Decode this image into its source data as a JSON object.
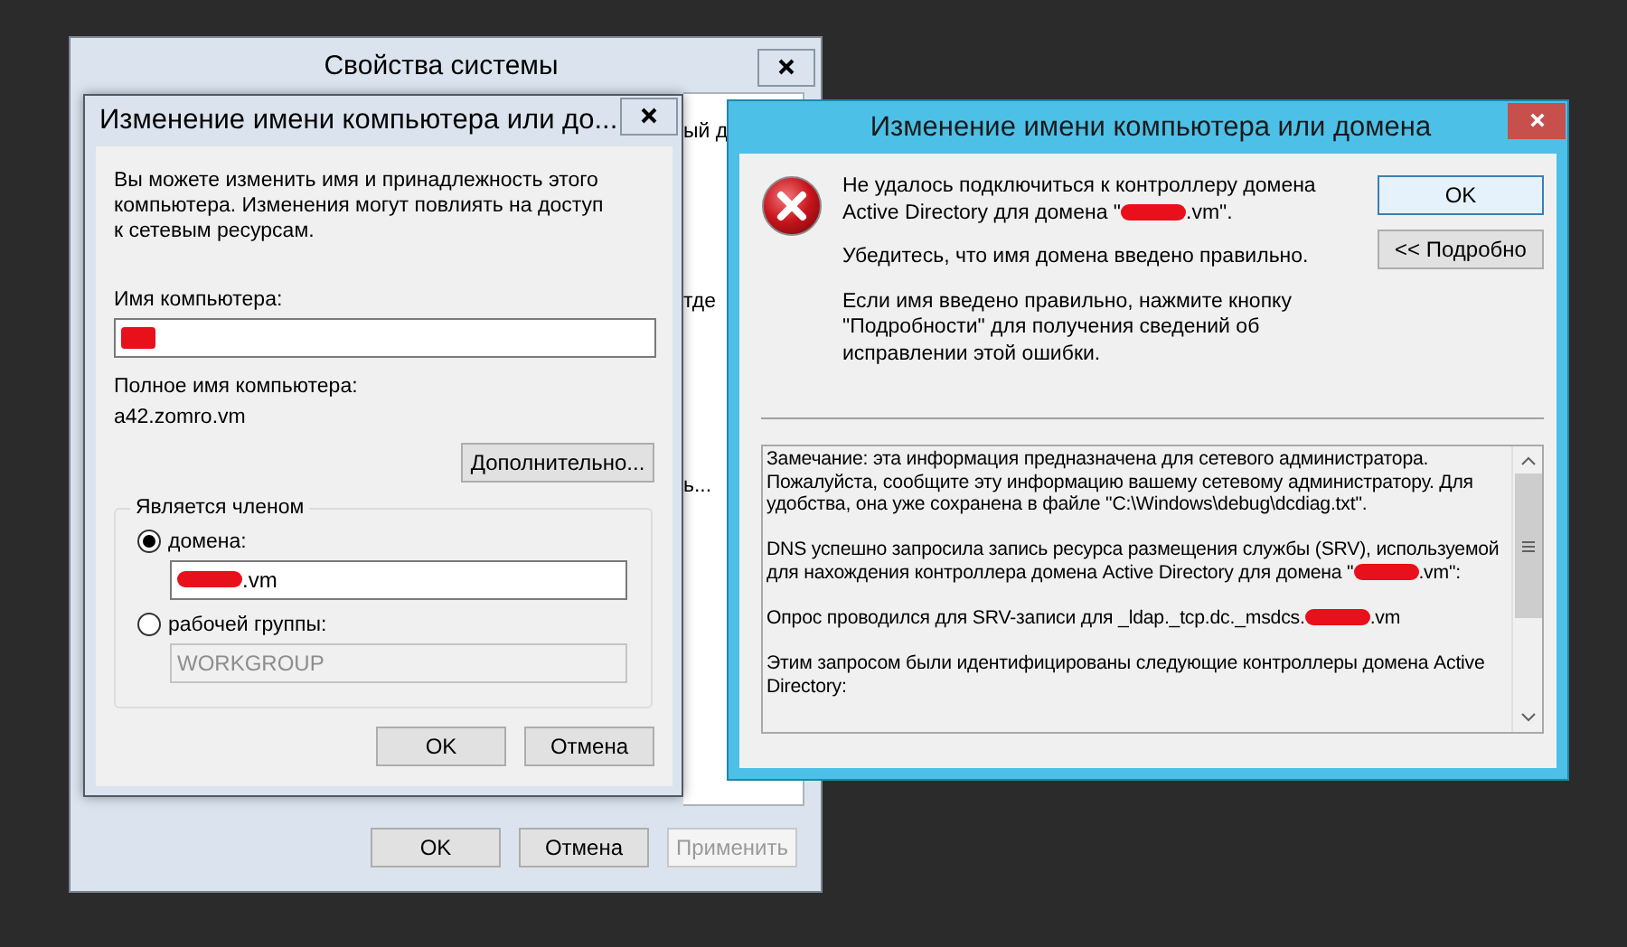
{
  "system_properties": {
    "title": "Свойства системы",
    "behind_fragments": [
      "ый д",
      "тде",
      "ь..."
    ],
    "buttons": [
      {
        "label": "OK",
        "disabled": false
      },
      {
        "label": "Отмена",
        "disabled": false
      },
      {
        "label": "Применить",
        "disabled": true
      }
    ]
  },
  "rename_dialog": {
    "title": "Изменение имени компьютера или до...",
    "intro": "Вы можете изменить имя и принадлежность этого компьютера. Изменения могут повлиять на доступ к сетевым ресурсам.",
    "computer_name_label": "Имя компьютера:",
    "computer_name_value": [
      {
        "kind": "redacted"
      }
    ],
    "full_name_label": "Полное имя компьютера:",
    "full_name": "a42.zomro.vm",
    "more_button": "Дополнительно...",
    "member_of": {
      "legend": "Является членом",
      "options": [
        {
          "label": "домена:",
          "selected": true,
          "disabled": false,
          "value": [
            {
              "kind": "redacted"
            },
            {
              "kind": "text",
              "text": ".vm"
            }
          ]
        },
        {
          "label": "рабочей группы:",
          "selected": false,
          "disabled": true,
          "value": [
            {
              "kind": "text",
              "text": "WORKGROUP"
            }
          ]
        }
      ]
    },
    "buttons": [
      {
        "label": "OK",
        "disabled": false
      },
      {
        "label": "Отмена",
        "disabled": false
      }
    ]
  },
  "error_dialog": {
    "title": "Изменение имени компьютера или домена",
    "message": [
      [
        {
          "kind": "text",
          "text": "Не удалось подключиться к контроллеру домена Active Directory для домена \""
        },
        {
          "kind": "redacted"
        },
        {
          "kind": "text",
          "text": ".vm\"."
        }
      ],
      [
        {
          "kind": "text",
          "text": "Убедитесь, что имя домена введено правильно."
        }
      ],
      [
        {
          "kind": "text",
          "text": "Если имя введено правильно, нажмите кнопку \"Подробности\" для получения сведений об исправлении этой ошибки."
        }
      ]
    ],
    "buttons": [
      {
        "label": "OK",
        "default": true
      },
      {
        "label": "<< Подробно",
        "default": false
      }
    ],
    "details": [
      [
        {
          "kind": "text",
          "text": "Замечание: эта информация предназначена для сетевого администратора. Пожалуйста, сообщите эту информацию вашему сетевому администратору. Для удобства, она уже сохранена в файле \"C:\\Windows\\debug\\dcdiag.txt\"."
        }
      ],
      [
        {
          "kind": "text",
          "text": "DNS успешно запросила запись ресурса размещения службы (SRV), используемой для нахождения контроллера домена Active Directory для домена \""
        },
        {
          "kind": "redacted"
        },
        {
          "kind": "text",
          "text": ".vm\":"
        }
      ],
      [
        {
          "kind": "text",
          "text": "Опрос проводился для SRV-записи для _ldap._tcp.dc._msdcs."
        },
        {
          "kind": "redacted"
        },
        {
          "kind": "text",
          "text": ".vm"
        }
      ],
      [
        {
          "kind": "text",
          "text": "Этим запросом были идентифицированы следующие контроллеры домена Active Directory:"
        }
      ]
    ]
  }
}
